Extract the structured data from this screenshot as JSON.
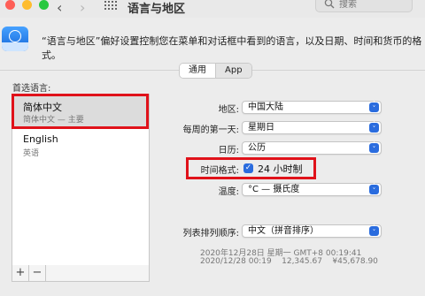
{
  "window": {
    "title": "语言与地区",
    "search_placeholder": "搜索",
    "traffic_colors": [
      "#fe5f57",
      "#febc2e",
      "#28c840"
    ],
    "back_icon": "chevron-left-icon",
    "forward_icon": "chevron-right-icon",
    "grid_icon": "grid-icon"
  },
  "header": {
    "icon": "language-flag-icon",
    "description": "“语言与地区”偏好设置控制您在菜单和对话框中看到的语言，以及日期、时间和货币的格式。"
  },
  "tabs": [
    {
      "label": "通用",
      "active": true
    },
    {
      "label": "App",
      "active": false
    }
  ],
  "languages": {
    "label": "首选语言:",
    "items": [
      {
        "name": "简体中文",
        "sub": "简体中文 — 主要",
        "selected": true
      },
      {
        "name": "English",
        "sub": "英语",
        "selected": false
      }
    ],
    "add_label": "+",
    "remove_label": "−"
  },
  "settings": {
    "region": {
      "label": "地区:",
      "value": "中国大陆"
    },
    "first_day": {
      "label": "每周的第一天:",
      "value": "星期日"
    },
    "calendar": {
      "label": "日历:",
      "value": "公历"
    },
    "time_format": {
      "label": "时间格式:",
      "checkbox_label": "24 小时制",
      "checked": true
    },
    "temperature": {
      "label": "温度:",
      "value": "°C — 摄氏度"
    },
    "list_sort": {
      "label": "列表排列顺序:",
      "value": "中文（拼音排序）"
    }
  },
  "samples": {
    "line1": "2020年12月28日 星期一 GMT+8 00:19:41",
    "line2": "2020/12/28 00:19    12,345.67    ¥45,678.90"
  },
  "colors": {
    "highlight": "#e0121a",
    "accent": "#2a6cde"
  }
}
